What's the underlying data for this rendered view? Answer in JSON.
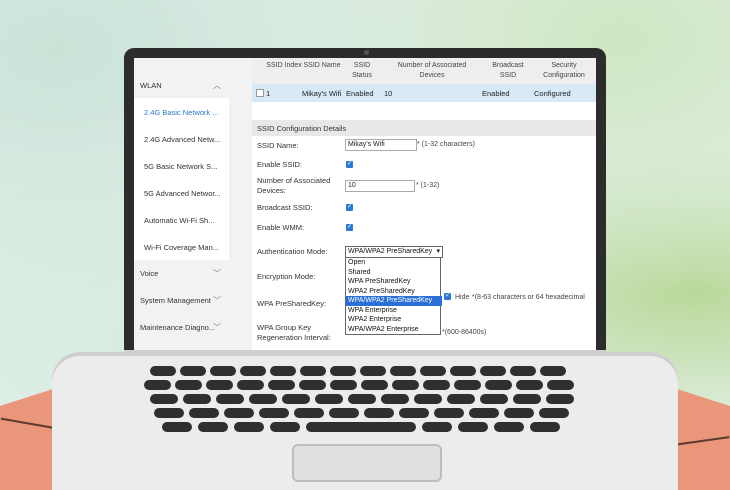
{
  "sidebar": {
    "groups": [
      {
        "label": "WLAN"
      },
      {
        "label": "Voice"
      },
      {
        "label": "System Management"
      },
      {
        "label": "Maintenance Diagno..."
      }
    ],
    "items": [
      {
        "label": "2.4G Basic Network ..."
      },
      {
        "label": "2.4G Advanced Netw..."
      },
      {
        "label": "5G Basic Network S..."
      },
      {
        "label": "5G Advanced Networ..."
      },
      {
        "label": "Automatic Wi-Fi Sh..."
      },
      {
        "label": "Wi-Fi Coverage Man..."
      }
    ]
  },
  "table": {
    "headers": [
      "SSID Index",
      "SSID Name",
      "SSID Status",
      "Number of Associated Devices",
      "Broadcast SSID",
      "Security Configuration"
    ],
    "row": [
      "1",
      "Mikay's Wifi",
      "Enabled",
      "10",
      "Enabled",
      "Configured"
    ]
  },
  "config": {
    "title": "SSID Configuration Details",
    "ssid_name_label": "SSID Name:",
    "ssid_name_value": "Mikay's Wifi",
    "ssid_name_hint": "* (1-32 characters)",
    "enable_ssid_label": "Enable SSID:",
    "devices_label_1": "Number of Associated",
    "devices_label_2": "Devices:",
    "devices_value": "10",
    "devices_hint": "* (1-32)",
    "broadcast_label": "Broadcast SSID:",
    "wmm_label": "Enable WMM:",
    "auth_label": "Authentication Mode:",
    "auth_value": "WPA/WPA2 PreSharedKey",
    "encryption_label": "Encryption Mode:",
    "psk_label": "WPA PreSharedKey:",
    "hide_label": "Hide",
    "psk_hint": "*(8-63 characters or 64 hexadecimal",
    "group_key_label_1": "WPA Group Key",
    "group_key_label_2": "Regeneration Interval:",
    "group_key_hint": "*(600-86400s)"
  },
  "auth_options": [
    "Open",
    "Shared",
    "WPA PreSharedKey",
    "WPA2 PreSharedKey",
    "WPA/WPA2 PreSharedKey",
    "WPA Enterprise",
    "WPA2 Enterprise",
    "WPA/WPA2 Enterprise"
  ],
  "selected_auth_option": "WPA/WPA2 PreSharedKey",
  "colors": {
    "accent": "#2b7bd0",
    "selected_option": "#2b6fd6",
    "row_highlight": "#d7e9f7",
    "desk": "#e9967a"
  }
}
